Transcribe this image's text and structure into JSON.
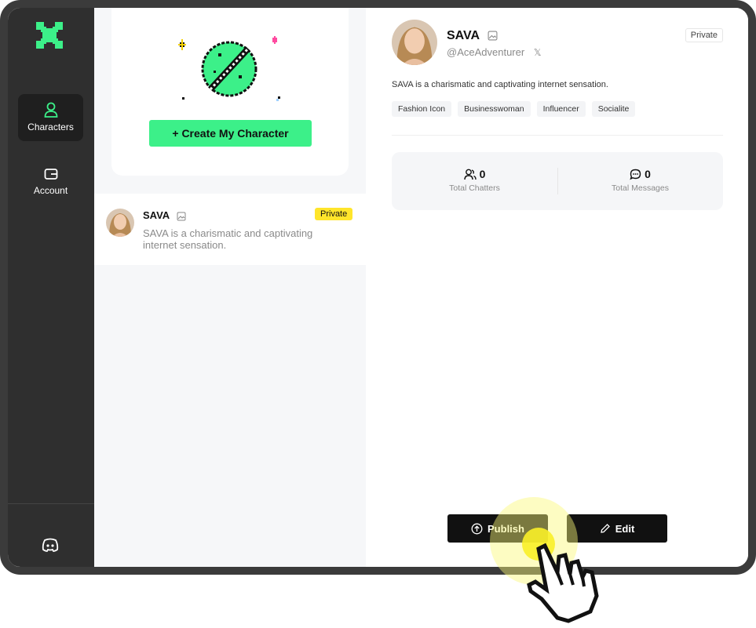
{
  "sidebar": {
    "items": [
      {
        "label": "Characters",
        "icon": "user-icon",
        "active": true
      },
      {
        "label": "Account",
        "icon": "wallet-icon",
        "active": false
      }
    ],
    "bottom_icon": "discord-icon"
  },
  "create": {
    "button_label": "+ Create My Character"
  },
  "list": [
    {
      "name": "SAVA",
      "badge": "Private",
      "description": "SAVA is a charismatic and captivating internet sensation."
    }
  ],
  "detail": {
    "name": "SAVA",
    "handle": "@AceAdventurer",
    "visibility": "Private",
    "description": "SAVA is a charismatic and captivating internet sensation.",
    "tags": [
      "Fashion Icon",
      "Businesswoman",
      "Influencer",
      "Socialite"
    ],
    "stats": {
      "chatters_value": "0",
      "chatters_label": "Total Chatters",
      "messages_value": "0",
      "messages_label": "Total Messages"
    },
    "publish_label": "Publish",
    "edit_label": "Edit"
  },
  "colors": {
    "brand_green": "#3cf089",
    "badge_yellow": "#ffe52b",
    "sidebar_bg": "#2f2f2f"
  }
}
